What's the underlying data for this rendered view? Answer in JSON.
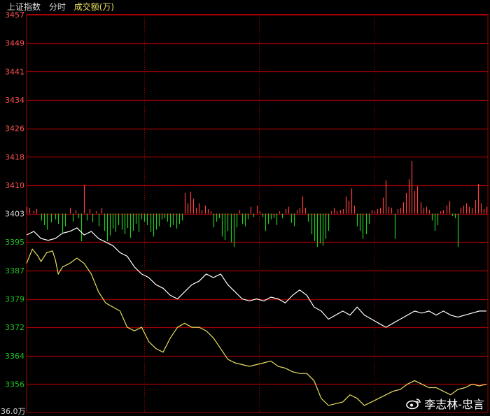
{
  "header": {
    "title": "上证指数",
    "period": "分时",
    "volume_label": "成交额(万)"
  },
  "watermark": {
    "text": "李志林-忠言"
  },
  "colors": {
    "up": "#ff4040",
    "down": "#22cc22",
    "grid": "#a00000",
    "price_line": "#ffffff",
    "avg_line": "#e8e060",
    "tick_up": "#ff5050",
    "tick_base": "#d8d8d8",
    "tick_down": "#20c020"
  },
  "chart_data": {
    "type": "line",
    "prev_close": 3403,
    "ylim": [
      3348,
      3457
    ],
    "y_ticks": [
      {
        "label": "3457",
        "value": 3457
      },
      {
        "label": "3449",
        "value": 3449
      },
      {
        "label": "3441",
        "value": 3441
      },
      {
        "label": "3434",
        "value": 3434
      },
      {
        "label": "3426",
        "value": 3426
      },
      {
        "label": "3418",
        "value": 3418
      },
      {
        "label": "3410",
        "value": 3410
      },
      {
        "label": "3403",
        "value": 3403
      },
      {
        "label": "3395",
        "value": 3395
      },
      {
        "label": "3387",
        "value": 3387
      },
      {
        "label": "3379",
        "value": 3379
      },
      {
        "label": "3372",
        "value": 3372
      },
      {
        "label": "3364",
        "value": 3364
      },
      {
        "label": "3356",
        "value": 3356
      }
    ],
    "volume_axis_label": "36.0万",
    "x_count": 241,
    "price_series": [
      [
        0,
        3397
      ],
      [
        5,
        3398
      ],
      [
        10,
        3396
      ],
      [
        15,
        3395.5
      ],
      [
        20,
        3396
      ],
      [
        25,
        3397.5
      ],
      [
        30,
        3398
      ],
      [
        35,
        3399
      ],
      [
        40,
        3397
      ],
      [
        45,
        3398
      ],
      [
        50,
        3396
      ],
      [
        55,
        3395
      ],
      [
        60,
        3394
      ],
      [
        65,
        3392
      ],
      [
        70,
        3391
      ],
      [
        75,
        3388
      ],
      [
        80,
        3386
      ],
      [
        85,
        3385
      ],
      [
        90,
        3383
      ],
      [
        95,
        3382
      ],
      [
        100,
        3380
      ],
      [
        105,
        3379
      ],
      [
        110,
        3381
      ],
      [
        115,
        3383
      ],
      [
        120,
        3384
      ],
      [
        125,
        3386
      ],
      [
        130,
        3385
      ],
      [
        135,
        3386
      ],
      [
        140,
        3383
      ],
      [
        145,
        3381
      ],
      [
        150,
        3379
      ],
      [
        155,
        3378.5
      ],
      [
        160,
        3379
      ],
      [
        165,
        3378.5
      ],
      [
        170,
        3379.5
      ],
      [
        175,
        3379
      ],
      [
        180,
        3378
      ],
      [
        185,
        3380
      ],
      [
        190,
        3381.5
      ],
      [
        195,
        3380
      ],
      [
        200,
        3377
      ],
      [
        205,
        3376
      ],
      [
        210,
        3374
      ],
      [
        215,
        3375
      ],
      [
        220,
        3376
      ],
      [
        225,
        3375
      ],
      [
        230,
        3377
      ],
      [
        235,
        3375
      ],
      [
        240,
        3374
      ],
      [
        245,
        3373
      ],
      [
        250,
        3372
      ],
      [
        255,
        3373
      ],
      [
        260,
        3374
      ],
      [
        265,
        3375
      ],
      [
        270,
        3376
      ],
      [
        275,
        3375.5
      ],
      [
        280,
        3376
      ],
      [
        285,
        3375
      ],
      [
        290,
        3376
      ],
      [
        295,
        3375
      ],
      [
        300,
        3374.5
      ],
      [
        305,
        3375
      ],
      [
        310,
        3375.5
      ],
      [
        315,
        3376
      ],
      [
        320,
        3376
      ]
    ],
    "avg_series": [
      [
        0,
        3389
      ],
      [
        4,
        3393
      ],
      [
        8,
        3391
      ],
      [
        10,
        3389.5
      ],
      [
        14,
        3392
      ],
      [
        18,
        3392.5
      ],
      [
        20,
        3390
      ],
      [
        22,
        3386
      ],
      [
        25,
        3388
      ],
      [
        30,
        3389
      ],
      [
        35,
        3390.5
      ],
      [
        40,
        3389
      ],
      [
        45,
        3386
      ],
      [
        50,
        3381
      ],
      [
        55,
        3378
      ],
      [
        60,
        3377
      ],
      [
        65,
        3376
      ],
      [
        70,
        3372
      ],
      [
        75,
        3371
      ],
      [
        80,
        3372
      ],
      [
        85,
        3368
      ],
      [
        90,
        3366
      ],
      [
        95,
        3365
      ],
      [
        100,
        3369
      ],
      [
        105,
        3372
      ],
      [
        110,
        3373
      ],
      [
        115,
        3372
      ],
      [
        120,
        3372
      ],
      [
        125,
        3371
      ],
      [
        130,
        3369
      ],
      [
        135,
        3366
      ],
      [
        140,
        3363
      ],
      [
        145,
        3362
      ],
      [
        150,
        3361.5
      ],
      [
        155,
        3361
      ],
      [
        160,
        3361.5
      ],
      [
        165,
        3362
      ],
      [
        170,
        3362.5
      ],
      [
        175,
        3361
      ],
      [
        180,
        3360.5
      ],
      [
        185,
        3359.5
      ],
      [
        190,
        3359
      ],
      [
        195,
        3359
      ],
      [
        200,
        3357
      ],
      [
        205,
        3352
      ],
      [
        210,
        3350
      ],
      [
        215,
        3350.5
      ],
      [
        220,
        3351
      ],
      [
        225,
        3353
      ],
      [
        230,
        3352
      ],
      [
        235,
        3350
      ],
      [
        240,
        3351
      ],
      [
        245,
        3352
      ],
      [
        250,
        3353
      ],
      [
        255,
        3354
      ],
      [
        260,
        3354.5
      ],
      [
        265,
        3356
      ],
      [
        270,
        3357
      ],
      [
        275,
        3356
      ],
      [
        280,
        3355
      ],
      [
        285,
        3355
      ],
      [
        290,
        3354
      ],
      [
        295,
        3353
      ],
      [
        300,
        3354.5
      ],
      [
        305,
        3355
      ],
      [
        310,
        3356
      ],
      [
        315,
        3355.5
      ],
      [
        320,
        3356
      ]
    ],
    "volume_bars": [
      [
        0,
        0.12
      ],
      [
        2,
        0.1
      ],
      [
        5,
        0.05
      ],
      [
        7,
        0.08
      ],
      [
        10,
        -0.12
      ],
      [
        12,
        -0.2
      ],
      [
        14,
        -0.28
      ],
      [
        17,
        -0.15
      ],
      [
        20,
        -0.1
      ],
      [
        22,
        -0.18
      ],
      [
        25,
        -0.35
      ],
      [
        27,
        -0.22
      ],
      [
        30,
        0.1
      ],
      [
        32,
        -0.14
      ],
      [
        34,
        0.06
      ],
      [
        36,
        -0.08
      ],
      [
        38,
        -0.48
      ],
      [
        40,
        0.5
      ],
      [
        42,
        -0.12
      ],
      [
        44,
        0.08
      ],
      [
        46,
        -0.15
      ],
      [
        48,
        0.04
      ],
      [
        50,
        -0.22
      ],
      [
        52,
        0.1
      ],
      [
        54,
        -0.3
      ],
      [
        56,
        -0.48
      ],
      [
        58,
        -0.38
      ],
      [
        60,
        -0.26
      ],
      [
        62,
        -0.32
      ],
      [
        64,
        -0.2
      ],
      [
        66,
        -0.28
      ],
      [
        68,
        -0.36
      ],
      [
        70,
        -0.25
      ],
      [
        72,
        -0.42
      ],
      [
        74,
        -0.3
      ],
      [
        76,
        -0.18
      ],
      [
        78,
        -0.32
      ],
      [
        80,
        -0.1
      ],
      [
        82,
        -0.14
      ],
      [
        84,
        -0.2
      ],
      [
        86,
        -0.32
      ],
      [
        88,
        -0.4
      ],
      [
        90,
        -0.28
      ],
      [
        92,
        -0.22
      ],
      [
        94,
        -0.1
      ],
      [
        96,
        -0.08
      ],
      [
        98,
        -0.14
      ],
      [
        100,
        -0.24
      ],
      [
        102,
        -0.2
      ],
      [
        104,
        -0.26
      ],
      [
        106,
        -0.18
      ],
      [
        108,
        -0.12
      ],
      [
        110,
        0.36
      ],
      [
        112,
        0.18
      ],
      [
        114,
        0.38
      ],
      [
        116,
        0.26
      ],
      [
        118,
        0.1
      ],
      [
        120,
        0.18
      ],
      [
        122,
        0.06
      ],
      [
        124,
        0.14
      ],
      [
        126,
        0.08
      ],
      [
        128,
        0.04
      ],
      [
        130,
        -0.24
      ],
      [
        132,
        -0.14
      ],
      [
        134,
        -0.08
      ],
      [
        136,
        -0.4
      ],
      [
        138,
        -0.46
      ],
      [
        140,
        -0.3
      ],
      [
        142,
        -0.5
      ],
      [
        144,
        -0.58
      ],
      [
        146,
        -0.24
      ],
      [
        148,
        0.06
      ],
      [
        150,
        -0.18
      ],
      [
        152,
        -0.22
      ],
      [
        154,
        -0.1
      ],
      [
        156,
        0.12
      ],
      [
        158,
        -0.06
      ],
      [
        160,
        0.14
      ],
      [
        162,
        0.04
      ],
      [
        164,
        -0.06
      ],
      [
        166,
        -0.3
      ],
      [
        168,
        -0.18
      ],
      [
        170,
        -0.1
      ],
      [
        172,
        -0.08
      ],
      [
        174,
        -0.2
      ],
      [
        176,
        0.04
      ],
      [
        178,
        -0.08
      ],
      [
        180,
        0.08
      ],
      [
        182,
        0.12
      ],
      [
        184,
        -0.16
      ],
      [
        186,
        -0.22
      ],
      [
        188,
        0.06
      ],
      [
        190,
        0.1
      ],
      [
        192,
        0.3
      ],
      [
        194,
        0.1
      ],
      [
        196,
        -0.14
      ],
      [
        198,
        -0.36
      ],
      [
        200,
        -0.48
      ],
      [
        202,
        -0.58
      ],
      [
        204,
        -0.52
      ],
      [
        206,
        -0.56
      ],
      [
        208,
        -0.44
      ],
      [
        210,
        -0.3
      ],
      [
        212,
        0.04
      ],
      [
        214,
        0.1
      ],
      [
        216,
        0.04
      ],
      [
        218,
        0.06
      ],
      [
        220,
        0.08
      ],
      [
        222,
        0.3
      ],
      [
        224,
        0.22
      ],
      [
        226,
        0.44
      ],
      [
        228,
        0.14
      ],
      [
        230,
        -0.22
      ],
      [
        232,
        -0.3
      ],
      [
        234,
        -0.44
      ],
      [
        236,
        -0.36
      ],
      [
        238,
        -0.18
      ],
      [
        240,
        0.06
      ],
      [
        242,
        0.04
      ],
      [
        244,
        0.08
      ],
      [
        246,
        0.1
      ],
      [
        248,
        0.28
      ],
      [
        250,
        0.58
      ],
      [
        252,
        0.12
      ],
      [
        254,
        0.1
      ],
      [
        256,
        -0.44
      ],
      [
        258,
        0.08
      ],
      [
        260,
        0.1
      ],
      [
        262,
        0.2
      ],
      [
        264,
        0.36
      ],
      [
        266,
        0.6
      ],
      [
        268,
        0.92
      ],
      [
        270,
        0.4
      ],
      [
        272,
        0.48
      ],
      [
        274,
        0.2
      ],
      [
        276,
        0.1
      ],
      [
        278,
        0.12
      ],
      [
        280,
        0.06
      ],
      [
        282,
        -0.12
      ],
      [
        284,
        -0.3
      ],
      [
        286,
        -0.2
      ],
      [
        288,
        0.04
      ],
      [
        290,
        0.06
      ],
      [
        292,
        0.14
      ],
      [
        294,
        0.22
      ],
      [
        296,
        -0.04
      ],
      [
        298,
        -0.08
      ],
      [
        300,
        -0.58
      ],
      [
        302,
        0.1
      ],
      [
        304,
        0.14
      ],
      [
        306,
        0.18
      ],
      [
        308,
        0.12
      ],
      [
        310,
        0.1
      ],
      [
        312,
        0.24
      ],
      [
        314,
        0.52
      ],
      [
        316,
        0.18
      ],
      [
        318,
        0.08
      ],
      [
        320,
        0.12
      ]
    ]
  }
}
